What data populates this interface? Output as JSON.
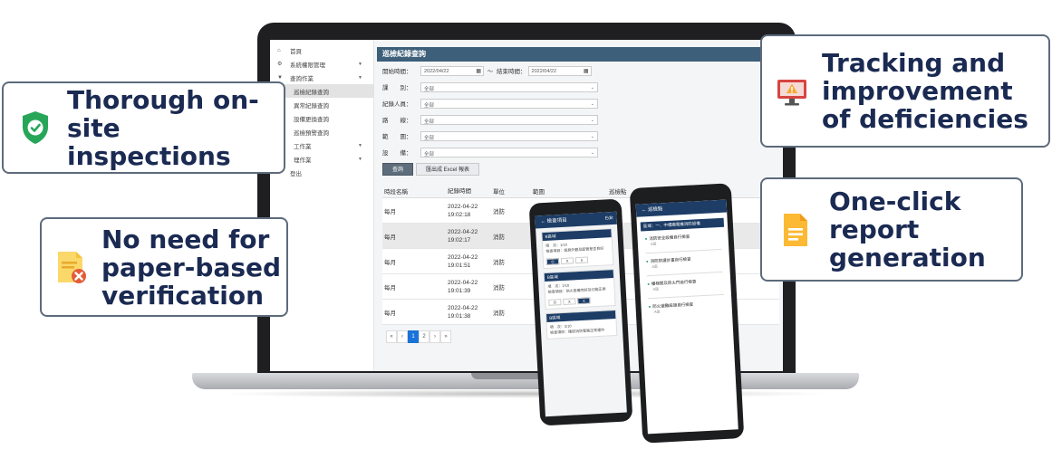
{
  "sidebar": {
    "items": [
      {
        "label": "首頁",
        "icon": "home-icon"
      },
      {
        "label": "系統權限管理",
        "icon": "gear-icon",
        "expandable": true
      },
      {
        "label": "查詢作業",
        "icon": "filter-icon",
        "expandable": true
      },
      {
        "label": "巡檢紀錄查詢",
        "active": true,
        "sub": true
      },
      {
        "label": "異常紀錄查詢",
        "sub": true
      },
      {
        "label": "設備更換查詢",
        "sub": true
      },
      {
        "label": "巡檢預警查詢",
        "sub": true
      },
      {
        "label": "工作業",
        "expandable": true
      },
      {
        "label": "理作業",
        "expandable": true
      },
      {
        "label": "登出",
        "icon": "logout-icon"
      }
    ]
  },
  "panel": {
    "title": "巡檢紀錄查詢",
    "start_label": "開始時間：",
    "start_value": "2022/04/22",
    "tilde": "～",
    "end_label": "結束時間：",
    "end_value": "2022/04/22",
    "filters": [
      {
        "label": "課　　別：",
        "value": "全部"
      },
      {
        "label": "紀錄人員：",
        "value": "全部"
      },
      {
        "label": "路　　線：",
        "value": "全部"
      },
      {
        "label": "範　　圍：",
        "value": "全部"
      },
      {
        "label": "設　　備：",
        "value": "全部"
      }
    ],
    "query_button": "查詢",
    "export_button": "匯出成 Excel 報表"
  },
  "table": {
    "headers": [
      "時段名稱",
      "紀錄時間",
      "單位",
      "範圍",
      "巡檢點"
    ],
    "rows": [
      {
        "period": "每月",
        "date": "2022-04-22",
        "time": "19:02:18",
        "unit": "消防"
      },
      {
        "period": "每月",
        "date": "2022-04-22",
        "time": "19:02:17",
        "unit": "消防"
      },
      {
        "period": "每月",
        "date": "2022-04-22",
        "time": "19:01:51",
        "unit": "消防"
      },
      {
        "period": "每月",
        "date": "2022-04-22",
        "time": "19:01:39",
        "unit": "消防"
      },
      {
        "period": "每月",
        "date": "2022-04-22",
        "time": "19:01:38",
        "unit": "消防"
      }
    ]
  },
  "pagination": [
    "«",
    "‹",
    "1",
    "2",
    "›",
    "»"
  ],
  "phone1": {
    "title": "檢查項目",
    "edit": "Edit",
    "cards": [
      {
        "header": "B區域",
        "line1": "項　次：1/10",
        "line2": "檢查項目：設施外觀及配管是否良好",
        "btns": [
          "O",
          "X",
          "X"
        ]
      },
      {
        "header": "B區域",
        "line1": "項　次：2/10",
        "line2": "檢查項目：防火設備完好及功能正常",
        "btns": [
          "O",
          "X",
          "X"
        ]
      },
      {
        "header": "B區域",
        "line1": "項　次：3/10",
        "line2": "檢查項目：確認消防管路正常運作",
        "btns": []
      }
    ]
  },
  "phone2": {
    "title": "巡檢點",
    "header": "區域：一、中壢廠電機消防設備",
    "items": [
      {
        "label": "消防安全設備自行檢查",
        "sub": "A區"
      },
      {
        "label": "消防防護計畫自行檢查",
        "sub": "A區"
      },
      {
        "label": "樓梯間及防火門自行檢查",
        "sub": "A區"
      },
      {
        "label": "防火避難設施自行檢查",
        "sub": "A區"
      }
    ]
  },
  "callouts": {
    "thorough": "Thorough on-site inspections",
    "tracking": "Tracking and improvement of deficiencies",
    "no_paper": "No need for paper-based verification",
    "one_click": "One-click report generation"
  },
  "colors": {
    "callout_text": "#1a2a52",
    "shield": "#27a65a",
    "header_bar": "#3d5f7a",
    "doc_orange": "#f7a935",
    "alert_red": "#d64541"
  }
}
